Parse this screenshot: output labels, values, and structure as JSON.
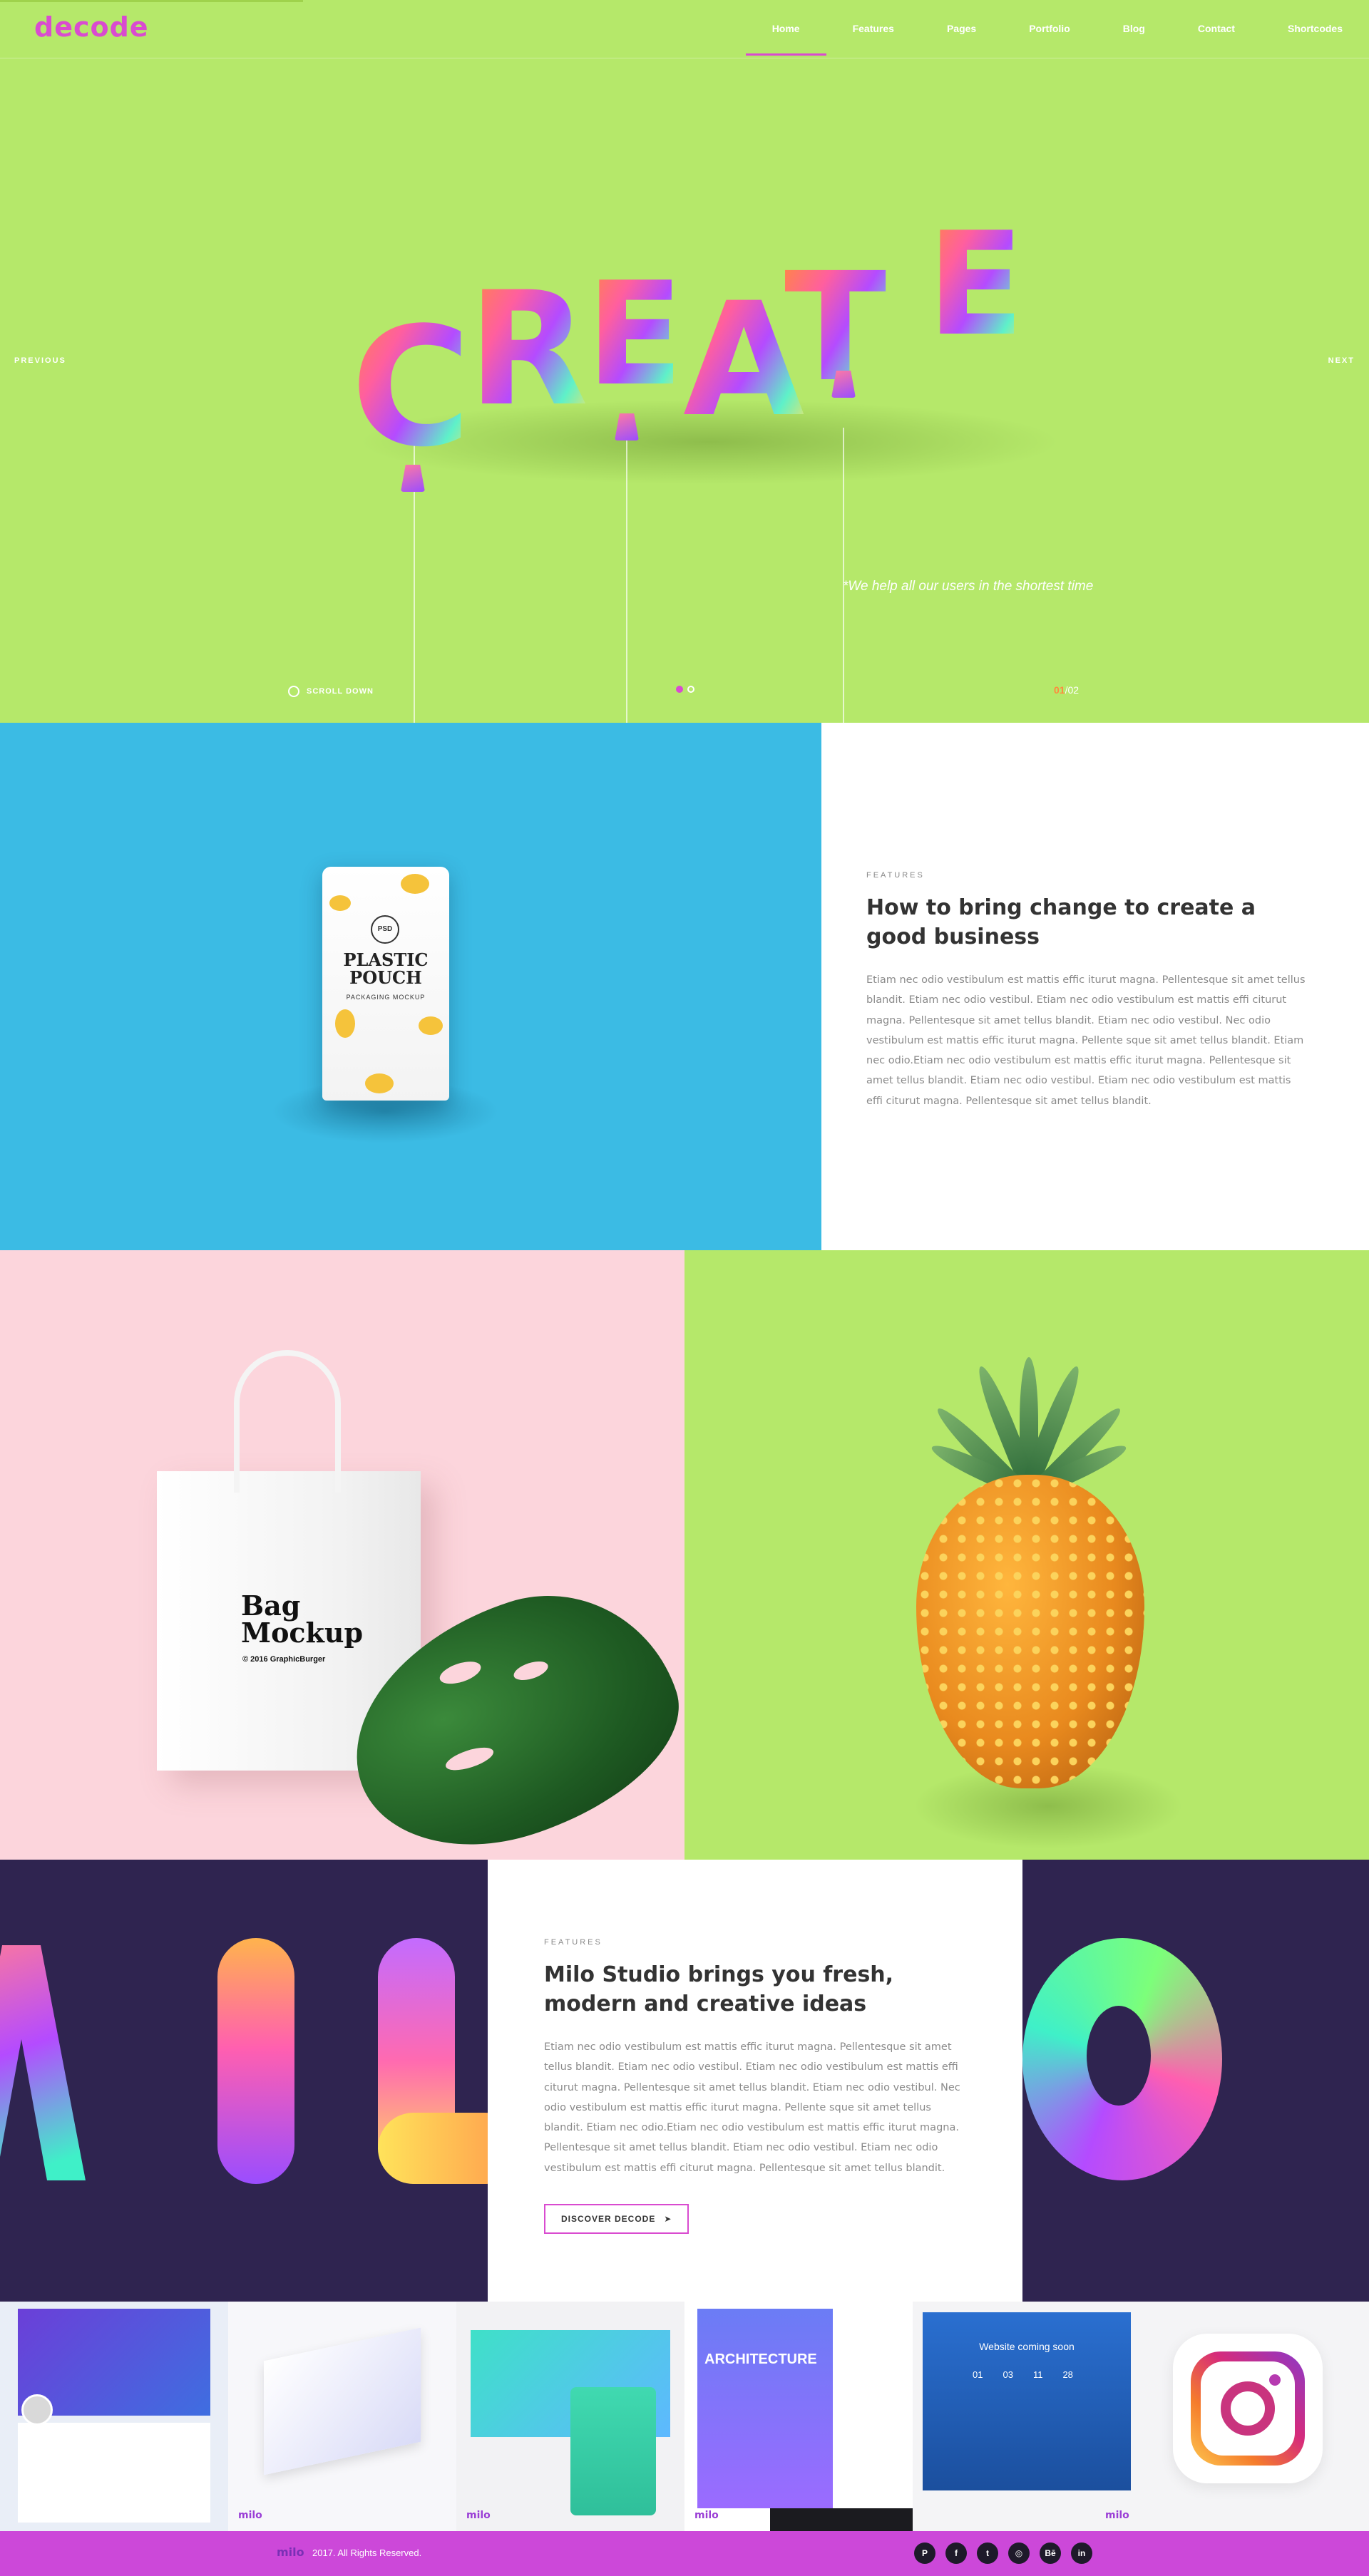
{
  "brand": {
    "logo": "decode"
  },
  "nav": {
    "items": [
      {
        "label": "Home",
        "active": true
      },
      {
        "label": "Features"
      },
      {
        "label": "Pages"
      },
      {
        "label": "Portfolio"
      },
      {
        "label": "Blog"
      },
      {
        "label": "Contact"
      },
      {
        "label": "Shortcodes"
      }
    ]
  },
  "hero": {
    "word": "CREATE",
    "previous": "PREVIOUS",
    "next": "NEXT",
    "tagline": "*We help all our users in the shortest time",
    "scroll_down": "SCROLL DOWN",
    "slide_current": "01",
    "slide_total": "/02"
  },
  "features1": {
    "eyebrow": "FEATURES",
    "title": "How to bring change to create a good business",
    "body": "Etiam nec odio vestibulum est mattis effic iturut magna. Pellentesque sit amet tellus blandit. Etiam nec odio vestibul. Etiam nec odio vestibulum est mattis effi citurut magna. Pellentesque sit amet tellus blandit. Etiam nec odio vestibul. Nec odio vestibulum est mattis effic iturut magna. Pellente sque sit amet tellus blandit. Etiam nec odio.Etiam nec odio vestibulum est mattis effic iturut magna. Pellentesque sit amet tellus blandit. Etiam nec odio vestibul. Etiam nec odio vestibulum est mattis effi citurut magna. Pellentesque sit amet tellus blandit.",
    "pouch": {
      "badge": "PSD",
      "title_line1": "PLASTIC",
      "title_line2": "POUCH",
      "subtitle": "PACKAGING MOCKUP"
    }
  },
  "mockup_bag": {
    "line1": "Bag",
    "line2": "Mockup",
    "credit": "© 2016 GraphicBurger"
  },
  "features2": {
    "eyebrow": "FEATURES",
    "title": "Milo Studio brings you fresh, modern and creative ideas",
    "body": "Etiam nec odio vestibulum est mattis effic iturut magna. Pellentesque sit amet tellus blandit. Etiam nec odio vestibul. Etiam nec odio vestibulum est mattis effi citurut magna. Pellentesque sit amet tellus blandit. Etiam nec odio vestibul. Nec odio vestibulum est mattis effic iturut magna. Pellente sque sit amet tellus blandit. Etiam nec odio.Etiam nec odio vestibulum est mattis effic iturut magna. Pellentesque sit amet tellus blandit. Etiam nec odio vestibul. Etiam nec odio vestibulum est mattis effi citurut magna. Pellentesque sit amet tellus blandit.",
    "button": "DISCOVER DECODE"
  },
  "gallery": {
    "tag": "milo",
    "architecture_title": "ARCHITECTURE",
    "coming_soon": "Website coming soon",
    "countdown": [
      "01",
      "03",
      "11",
      "28"
    ]
  },
  "footer": {
    "logo": "milo",
    "copyright": "2017. All Rights Reserved.",
    "socials": [
      "P",
      "f",
      "t",
      "◎",
      "Bē",
      "in"
    ]
  },
  "colors": {
    "lime": "#b5e86a",
    "magenta": "#d94bd0",
    "sky": "#3bbbe4",
    "pink": "#fcd5dc",
    "navy": "#2f2450",
    "footer": "#cc48d9"
  }
}
